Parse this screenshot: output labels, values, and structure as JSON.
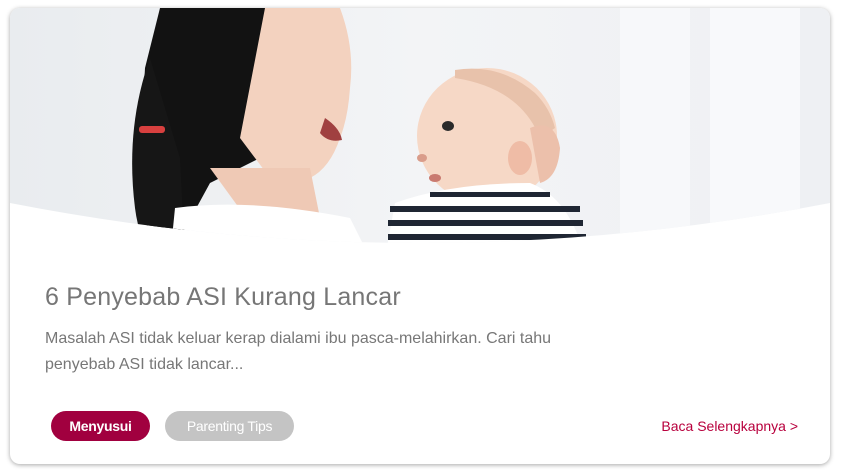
{
  "article": {
    "image": "mother-holding-baby-photo",
    "title": "6 Penyebab ASI Kurang Lancar",
    "excerpt_line1": "Masalah ASI tidak keluar kerap dialami ibu pasca-melahirkan. Cari tahu",
    "excerpt_line2": "penyebab ASI tidak lancar...",
    "tags": [
      "Menyusui",
      "Parenting Tips"
    ],
    "read_more": "Baca Selengkapnya >"
  },
  "colors": {
    "accent": "#a1003f",
    "tag_secondary": "#c4c4c4",
    "title_text": "#767676",
    "link": "#b8003d"
  }
}
